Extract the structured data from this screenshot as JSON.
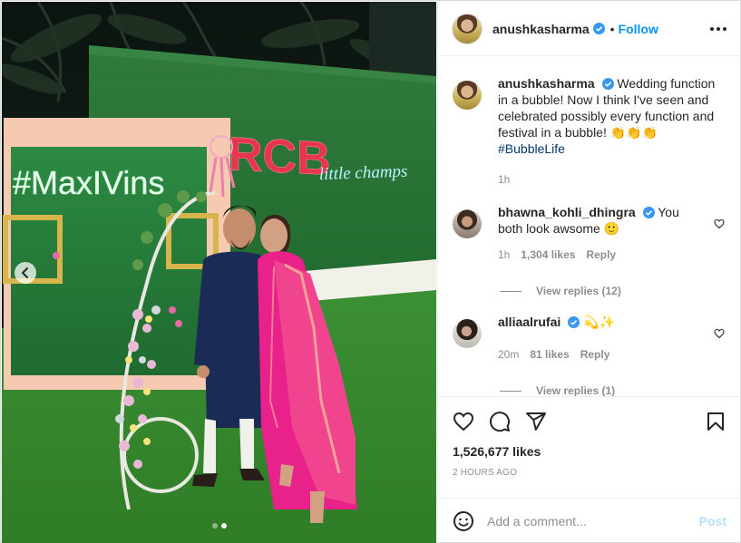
{
  "post": {
    "author": "anushkasharma",
    "follow_label": "Follow",
    "separator": "•",
    "caption": {
      "username": "anushkasharma",
      "text": "Wedding function in a bubble! Now I think I've seen and celebrated possibly every function and festival in a bubble! 👏👏👏",
      "hashtag": "#BubbleLife",
      "time": "1h"
    },
    "likes": "1,526,677 likes",
    "timestamp": "2 HOURS AGO"
  },
  "photo": {
    "sign_text": "#MaxIVins",
    "logo_main": "RCB",
    "logo_sub": "little champs",
    "carousel": {
      "total": 2,
      "active": 2
    }
  },
  "comments": [
    {
      "username": "bhawna_kohli_dhingra",
      "text": "You both look awsome 🙂",
      "time": "1h",
      "likes": "1,304 likes",
      "reply": "Reply",
      "view_replies": "View replies (12)"
    },
    {
      "username": "alliaalrufai",
      "text": "💫✨",
      "time": "20m",
      "likes": "81 likes",
      "reply": "Reply",
      "view_replies": "View replies (1)"
    }
  ],
  "add_comment": {
    "placeholder": "Add a comment...",
    "post_label": "Post"
  },
  "icons": [
    "heart-icon",
    "comment-icon",
    "share-icon",
    "bookmark-icon",
    "emoji-icon",
    "verified-badge-icon",
    "more-options-icon",
    "chevron-left-icon"
  ],
  "colors": {
    "link_blue": "#0095f6",
    "text": "#262626",
    "muted": "#8e8e8e",
    "post_disabled": "#b2dffc",
    "hashtag": "#00376b"
  }
}
